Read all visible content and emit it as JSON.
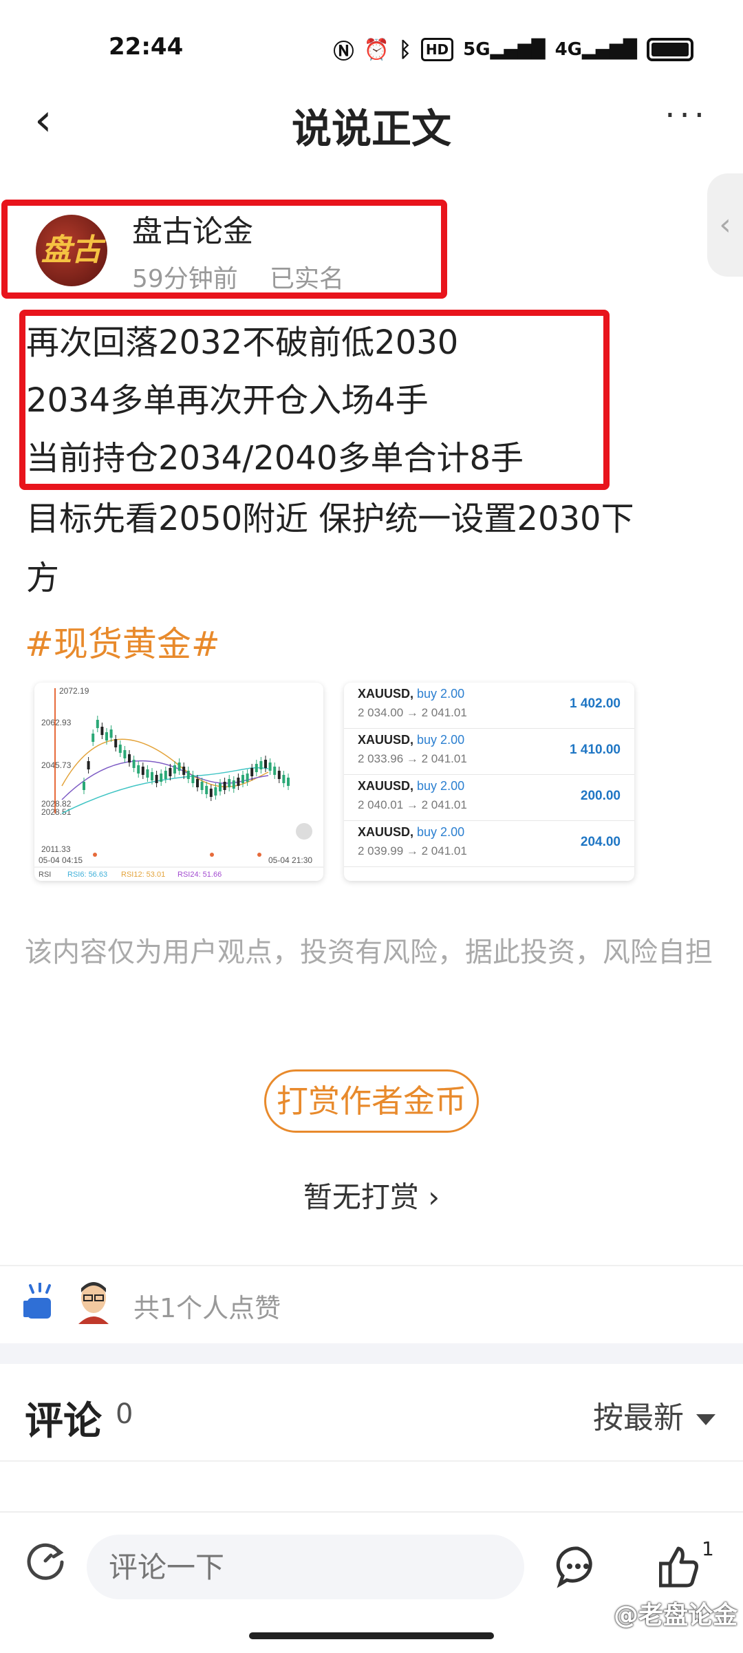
{
  "status_bar": {
    "time": "22:44",
    "icons": [
      "nfc-icon",
      "alarm-icon",
      "bluetooth-icon",
      "hd-icon",
      "5g-signal-icon",
      "4g-signal-icon",
      "battery-icon"
    ],
    "hd_label": "HD",
    "net5g": "5G",
    "net4g": "4G"
  },
  "nav": {
    "back_icon": "‹",
    "title": "说说正文",
    "more_icon": "···"
  },
  "side_tab_icon": "‹",
  "author": {
    "name": "盘古论金",
    "avatar_text": "盘古",
    "time": "59分钟前",
    "verified": "已实名"
  },
  "post": {
    "lines": [
      "再次回落2032不破前低2030",
      "2034多单再次开仓入场4手",
      "当前持仓2034/2040多单合计8手",
      "目标先看2050附近 保护统一设置2030下",
      "方"
    ],
    "hashtag": "#现货黄金#"
  },
  "chart_thumb": {
    "price_labels": [
      "2072.19",
      "2062.93",
      "2045.73",
      "2028.82",
      "2028.51",
      "2011.33"
    ],
    "time_labels": [
      "05-04 04:15",
      "05-04 21:30"
    ],
    "rsi_label": "RSI",
    "rsi_values": [
      "RSI6: 56.63",
      "RSI12: 53.01",
      "RSI24: 51.66"
    ],
    "colors": {
      "up": "#2aa876",
      "down": "#222222",
      "ma1": "#e3a33a",
      "ma2": "#7c5ac4",
      "ma3": "#3fc4c4",
      "rsi6": "#3fb0d9",
      "rsi12": "#e3a33a",
      "rsi24": "#a24ad0"
    }
  },
  "trades": [
    {
      "symbol": "XAUUSD,",
      "dir": "buy 2.00",
      "prices": "2 034.00 → 2 041.01",
      "pl": "1 402.00"
    },
    {
      "symbol": "XAUUSD,",
      "dir": "buy 2.00",
      "prices": "2 033.96 → 2 041.01",
      "pl": "1 410.00"
    },
    {
      "symbol": "XAUUSD,",
      "dir": "buy 2.00",
      "prices": "2 040.01 → 2 041.01",
      "pl": "200.00"
    },
    {
      "symbol": "XAUUSD,",
      "dir": "buy 2.00",
      "prices": "2 039.99 → 2 041.01",
      "pl": "204.00"
    }
  ],
  "disclaimer": "该内容仅为用户观点，投资有风险，据此投资，风险自担",
  "reward": {
    "button": "打赏作者金币",
    "none": "暂无打赏 ›"
  },
  "likes": {
    "text": "共1个人点赞"
  },
  "comments": {
    "title": "评论",
    "count": "0",
    "sort": "按最新"
  },
  "bottom_bar": {
    "input_placeholder": "评论一下",
    "like_count": "1"
  },
  "watermark": "@老盘论金",
  "colors": {
    "accent": "#e88a2c",
    "highlight_box": "#e8141c",
    "link_blue": "#1f76c4"
  }
}
